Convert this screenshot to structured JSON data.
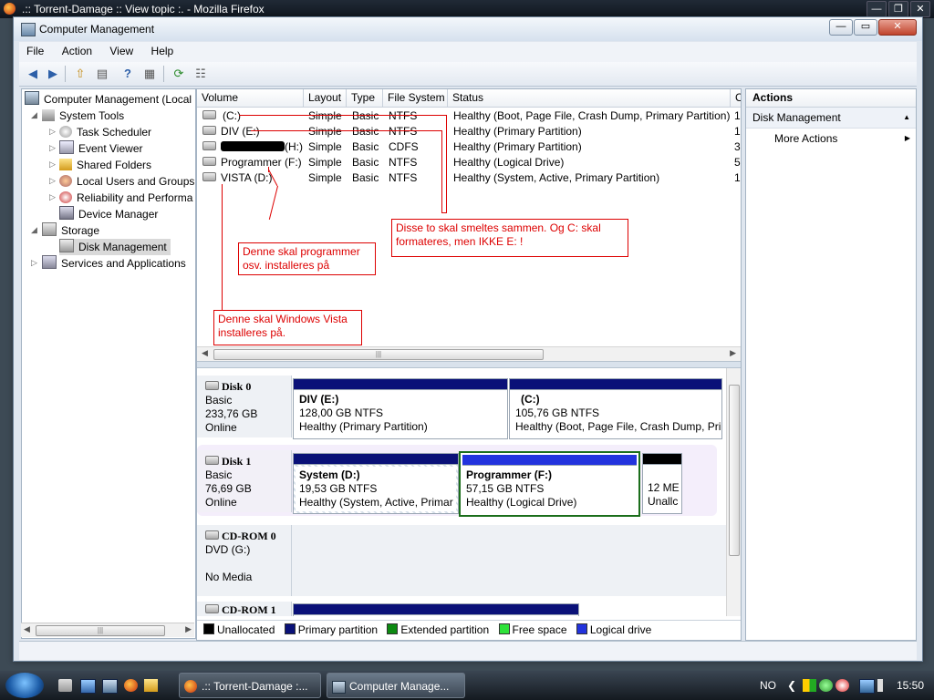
{
  "firefox": {
    "title": ".:: Torrent-Damage :: View topic :. - Mozilla Firefox",
    "ctrl_min": "—",
    "ctrl_max": "❐",
    "ctrl_close": "✕"
  },
  "window": {
    "title": "Computer Management",
    "ctrl_min": "—",
    "ctrl_max": "▭",
    "ctrl_close": "✕"
  },
  "menu": [
    "File",
    "Action",
    "View",
    "Help"
  ],
  "toolbar": {
    "back": "◀",
    "forward": "▶",
    "up": "⇧",
    "show_hide": "▤",
    "help": "?",
    "pane": "▦",
    "refresh": "⟳",
    "properties": "☷"
  },
  "tree": {
    "root": "Computer Management (Local",
    "system_tools": "System Tools",
    "task_scheduler": "Task Scheduler",
    "event_viewer": "Event Viewer",
    "shared_folders": "Shared Folders",
    "local_users": "Local Users and Groups",
    "reliability": "Reliability and Performa",
    "device_manager": "Device Manager",
    "storage": "Storage",
    "disk_management": "Disk Management",
    "services": "Services and Applications",
    "expand": "▷",
    "collapse": "◢",
    "scroll_grip": "|||",
    "scroll_left": "◀",
    "scroll_right": "▶"
  },
  "volume_table": {
    "headers": [
      "Volume",
      "Layout",
      "Type",
      "File System",
      "Status",
      "C"
    ],
    "rows": [
      {
        "volume": "(C:)",
        "layout": "Simple",
        "type": "Basic",
        "fs": "NTFS",
        "status": "Healthy (Boot, Page File, Crash Dump, Primary Partition)",
        "c": "1"
      },
      {
        "volume": "DIV (E:)",
        "layout": "Simple",
        "type": "Basic",
        "fs": "NTFS",
        "status": "Healthy (Primary Partition)",
        "c": "1"
      },
      {
        "volume": "(H:)",
        "layout": "Simple",
        "type": "Basic",
        "fs": "CDFS",
        "status": "Healthy (Primary Partition)",
        "c": "3"
      },
      {
        "volume": "Programmer (F:)",
        "layout": "Simple",
        "type": "Basic",
        "fs": "NTFS",
        "status": "Healthy (Logical Drive)",
        "c": "5"
      },
      {
        "volume": "VISTA (D:)",
        "layout": "Simple",
        "type": "Basic",
        "fs": "NTFS",
        "status": "Healthy (System, Active, Primary Partition)",
        "c": "1"
      }
    ],
    "scroll_grip": "|||",
    "scroll_left": "◀",
    "scroll_right": "▶"
  },
  "annotations": {
    "merge_note": "Disse to skal smeltes sammen. Og C: skal formateres, men IKKE E: !",
    "programs_note": "Denne skal programmer osv. installeres på",
    "vista_note": "Denne skal Windows Vista installeres på."
  },
  "disks": [
    {
      "name": "Disk 0",
      "type": "Basic",
      "size": "233,76 GB",
      "state": "Online",
      "partitions": [
        {
          "name": "DIV  (E:)",
          "size": "128,00 GB NTFS",
          "status": "Healthy (Primary Partition)"
        },
        {
          "name": "(C:)",
          "size": "105,76 GB NTFS",
          "status": "Healthy (Boot, Page File, Crash Dump, Pri"
        }
      ]
    },
    {
      "name": "Disk 1",
      "type": "Basic",
      "size": "76,69 GB",
      "state": "Online",
      "partitions": [
        {
          "name": "System  (D:)",
          "size": "19,53 GB NTFS",
          "status": "Healthy (System, Active, Primar"
        },
        {
          "name": "Programmer  (F:)",
          "size": "57,15 GB NTFS",
          "status": "Healthy (Logical Drive)"
        },
        {
          "name": "",
          "size": "12 ME",
          "status": "Unallc"
        }
      ]
    },
    {
      "name": "CD-ROM 0",
      "type": "DVD (G:)",
      "size": "",
      "state": "No Media"
    },
    {
      "name": "CD-ROM 1"
    }
  ],
  "legend": [
    {
      "label": "Unallocated",
      "color": "#000000"
    },
    {
      "label": "Primary partition",
      "color": "#0a1178"
    },
    {
      "label": "Extended partition",
      "color": "#0d8a12"
    },
    {
      "label": "Free space",
      "color": "#2ee23a"
    },
    {
      "label": "Logical drive",
      "color": "#2233dd"
    }
  ],
  "actions": {
    "header": "Actions",
    "section": "Disk Management",
    "section_arrow": "▲",
    "more": "More Actions",
    "more_arrow": "▶"
  },
  "taskbar": {
    "tasks": [
      ".:: Torrent-Damage :...",
      "Computer Manage..."
    ],
    "language": "NO",
    "tray_arrow": "❮",
    "clock": "15:50"
  }
}
